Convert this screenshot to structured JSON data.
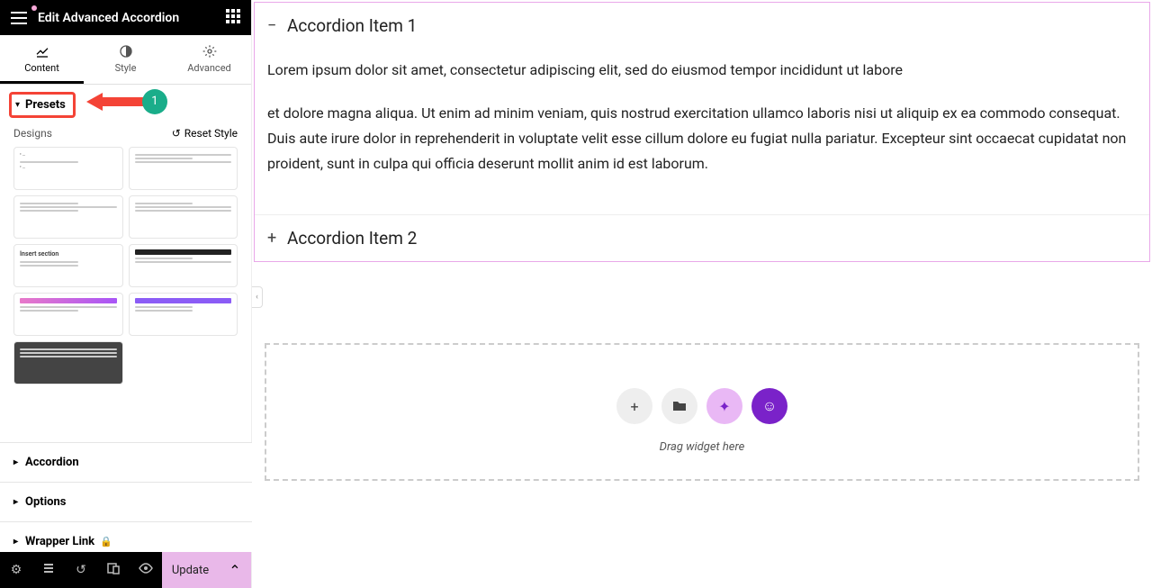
{
  "header": {
    "title": "Edit Advanced Accordion"
  },
  "tabs": {
    "content": "Content",
    "style": "Style",
    "advanced": "Advanced"
  },
  "sections": {
    "presets": "Presets",
    "designs": "Designs",
    "reset": "Reset Style",
    "accordion": "Accordion",
    "options": "Options",
    "wrapper": "Wrapper Link"
  },
  "annotation": {
    "step": "1"
  },
  "footer": {
    "update": "Update"
  },
  "canvas": {
    "item1_title": "Accordion Item 1",
    "item2_title": "Accordion Item 2",
    "p1": "Lorem ipsum dolor sit amet, consectetur adipiscing elit, sed do eiusmod tempor incididunt ut labore",
    "p2": "et dolore magna aliqua. Ut enim ad minim veniam, quis nostrud exercitation ullamco laboris nisi ut aliquip ex ea commodo consequat. Duis aute irure dolor in reprehenderit in voluptate velit esse cillum dolore eu fugiat nulla pariatur. Excepteur sint occaecat cupidatat non proident, sunt in culpa qui officia deserunt mollit anim id est laborum.",
    "drag_text": "Drag widget here"
  }
}
